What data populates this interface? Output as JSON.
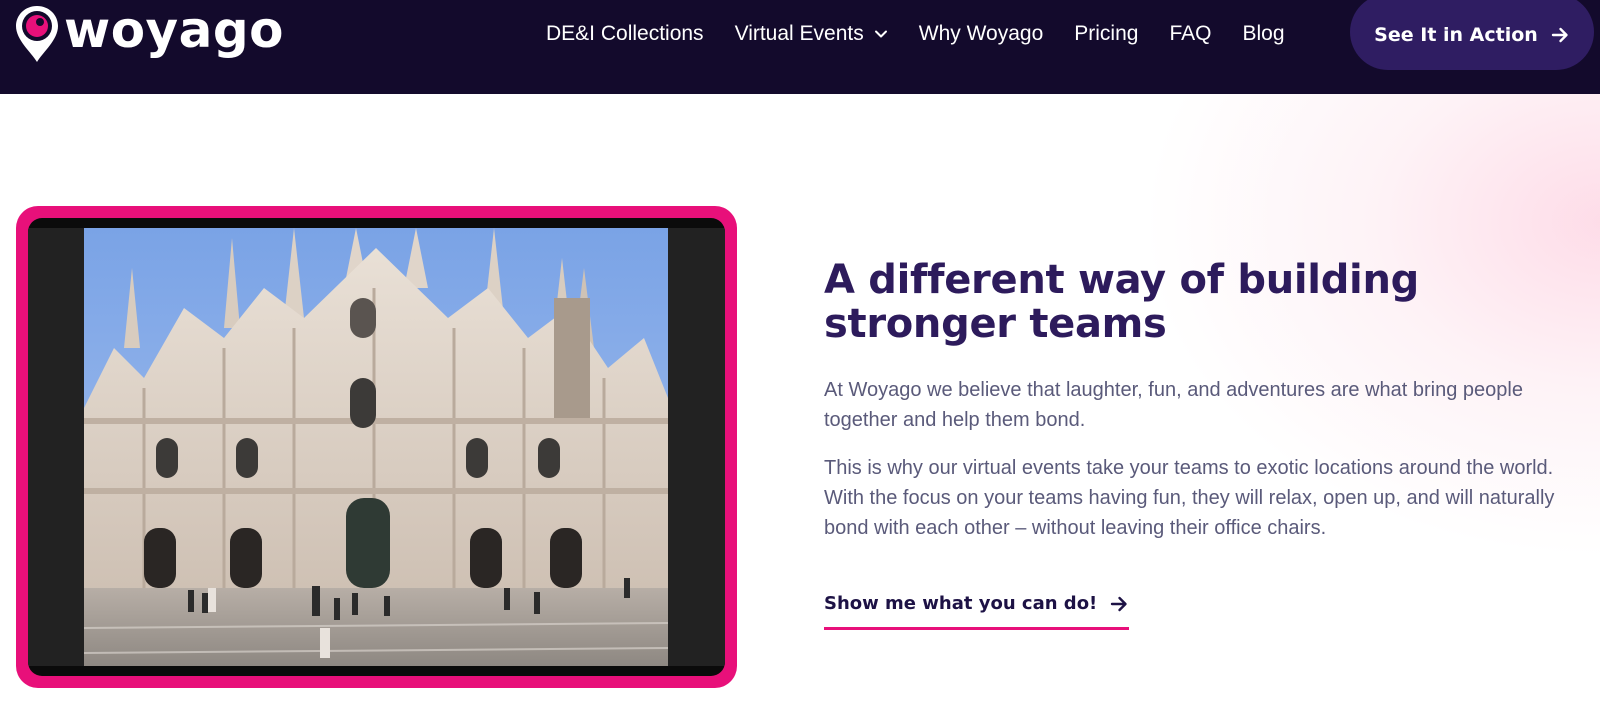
{
  "brand": {
    "name": "woyago",
    "pin_color": "#e8107a"
  },
  "nav": {
    "links": [
      {
        "label": "DE&I Collections"
      },
      {
        "label": "Virtual Events",
        "has_dropdown": true
      },
      {
        "label": "Why Woyago"
      },
      {
        "label": "Pricing"
      },
      {
        "label": "FAQ"
      },
      {
        "label": "Blog"
      }
    ],
    "cta_label": "See It in Action",
    "background": "#130a2c",
    "cta_background": "#2f1d62"
  },
  "hero": {
    "heading": "A different way of building stronger teams",
    "paragraphs": [
      "At Woyago we believe that laughter, fun, and adventures are what bring people together and help them bond.",
      "This is why our virtual events take your teams to exotic locations around the world. With the focus on your teams having fun, they will relax, open up, and will naturally bond with each other – without leaving their office chairs."
    ],
    "link_label": "Show me what you can do!",
    "media_icon": "cathedral-video-still",
    "frame_color": "#e8107a",
    "heading_color": "#2d1b5c"
  },
  "icons": {
    "dropdown": "chevron-down-icon",
    "arrow": "arrow-right-icon"
  }
}
